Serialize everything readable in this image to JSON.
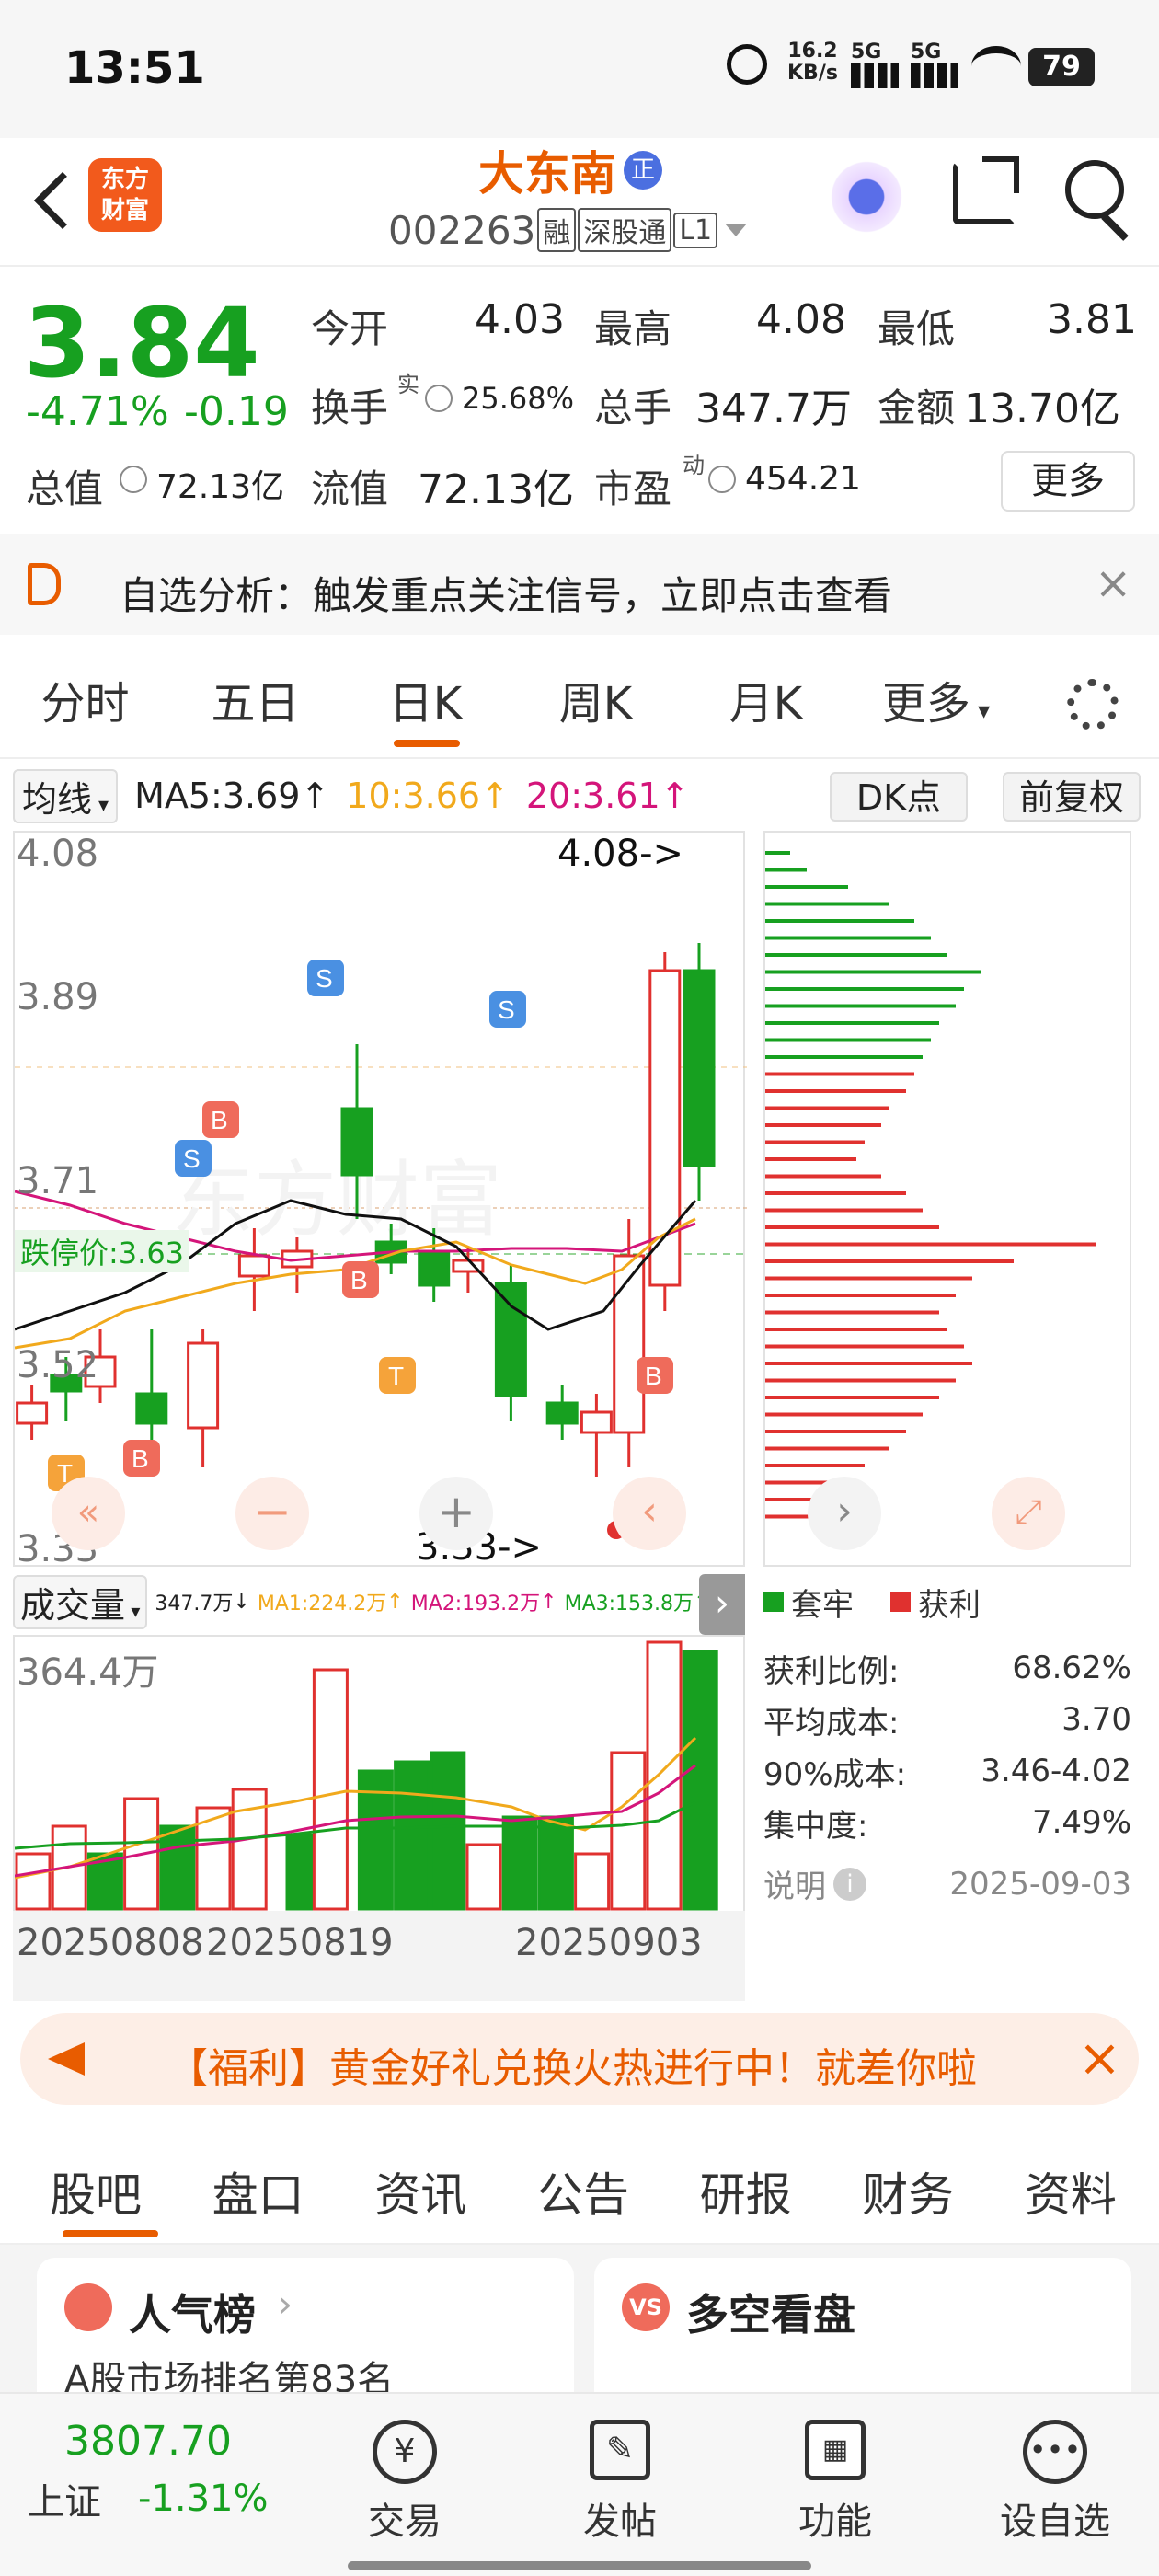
{
  "status": {
    "time": "13:51",
    "net_speed": "16.2",
    "net_unit": "KB/s",
    "sig1": "5G",
    "sig2": "5G",
    "battery": "79"
  },
  "header": {
    "logo_line1": "东方",
    "logo_line2": "财富",
    "name": "大东南",
    "name_badge": "正",
    "code": "002263",
    "tags": [
      "融",
      "深股通",
      "L1"
    ]
  },
  "quote": {
    "price": "3.84",
    "change_pct": "-4.71%",
    "change": "-0.19",
    "open_label": "今开",
    "open": "4.03",
    "high_label": "最高",
    "high": "4.08",
    "low_label": "最低",
    "low": "3.81",
    "turnover_label": "换手",
    "turnover_sup": "实",
    "turnover": "25.68%",
    "volume_label": "总手",
    "volume": "347.7万",
    "amount_label": "金额",
    "amount": "13.70亿",
    "mcap_label": "总值",
    "mcap": "72.13亿",
    "float_label": "流值",
    "float": "72.13亿",
    "pe_label": "市盈",
    "pe_sup": "动",
    "pe": "454.21",
    "more": "更多"
  },
  "alert": {
    "text": "自选分析：触发重点关注信号，立即点击查看"
  },
  "tabs": {
    "items": [
      "分时",
      "五日",
      "日K",
      "周K",
      "月K",
      "更多"
    ],
    "active": 2
  },
  "ma_bar": {
    "selector": "均线",
    "ma5": "MA5:3.69",
    "ma10": "10:3.66",
    "ma20": "20:3.61",
    "dk": "DK点",
    "adjust": "前复权"
  },
  "kchart": {
    "y_labels": [
      "4.08",
      "3.89",
      "3.71",
      "3.52",
      "3.33"
    ],
    "limit_down": "跌停价:3.63",
    "high_marker": "4.08->",
    "low_marker": "3.33->"
  },
  "volume": {
    "selector": "成交量",
    "vol": "347.7万",
    "ma1": "MA1:224.2万",
    "ma2": "MA2:193.2万",
    "ma3": "MA3:153.8万",
    "max_label": "364.4万",
    "dates": [
      "20250808",
      "20250819",
      "20250903"
    ]
  },
  "chips": {
    "legend_trapped": "套牢",
    "legend_profit": "获利",
    "rows": [
      {
        "label": "获利比例:",
        "value": "68.62%"
      },
      {
        "label": "平均成本:",
        "value": "3.70"
      },
      {
        "label": "90%成本:",
        "value": "3.46-4.02"
      },
      {
        "label": "集中度:",
        "value": "7.49%"
      }
    ],
    "note": "说明",
    "date": "2025-09-03"
  },
  "banner": {
    "text": "【福利】黄金好礼兑换火热进行中！就差你啦"
  },
  "section_tabs": {
    "items": [
      "股吧",
      "盘口",
      "资讯",
      "公告",
      "研报",
      "财务",
      "资料"
    ],
    "active": 0
  },
  "cards": {
    "left_title": "人气榜",
    "left_sub": "A股市场排名第83名",
    "right_title": "多空看盘"
  },
  "bottom": {
    "index_value": "3807.70",
    "index_name": "上证",
    "index_change": "-1.31%",
    "items": [
      "交易",
      "发帖",
      "功能",
      "设自选"
    ]
  },
  "colors": {
    "up": "#e0312f",
    "down": "#17a020",
    "accent": "#e85c00"
  }
}
